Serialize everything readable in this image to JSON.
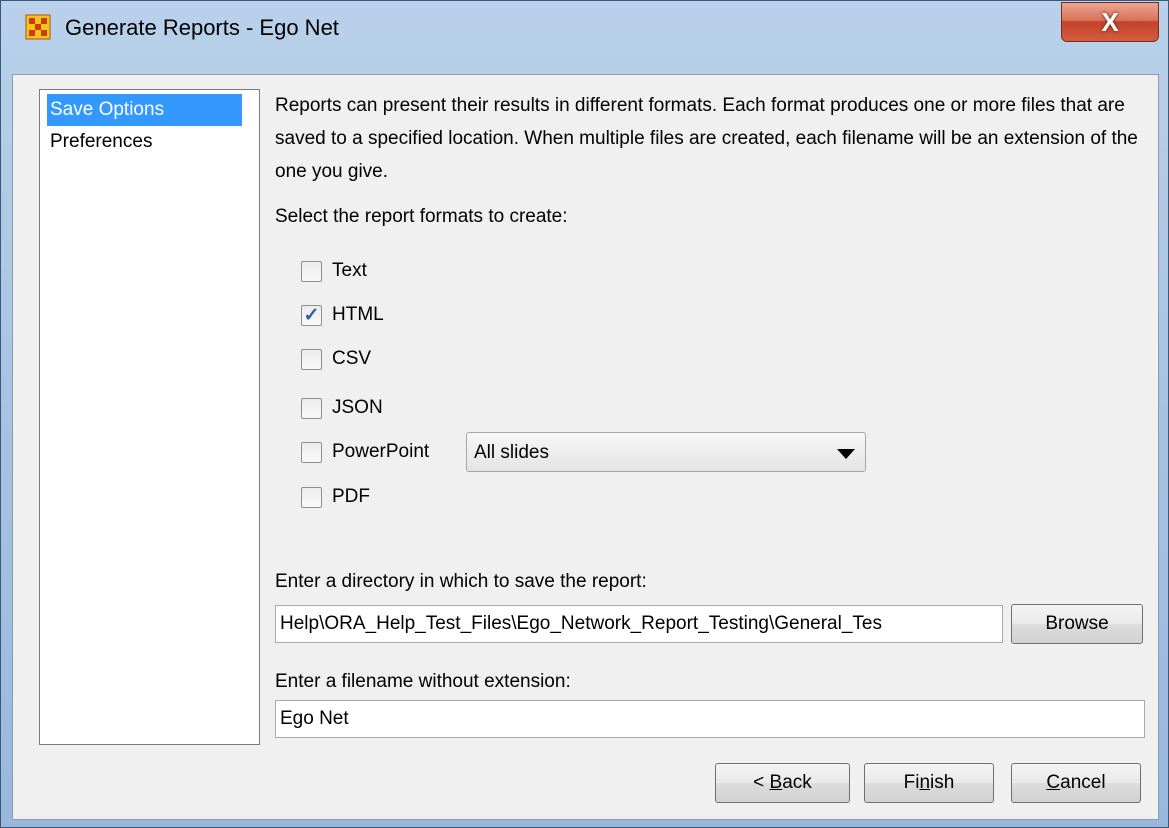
{
  "window": {
    "title": "Generate Reports - Ego Net",
    "close_symbol": "X"
  },
  "sidebar": {
    "items": [
      {
        "label": "Save Options",
        "selected": true
      },
      {
        "label": "Preferences",
        "selected": false
      }
    ]
  },
  "save_options": {
    "description": "Reports can present their results in different formats. Each format produces one or more files that are saved to a specified location. When multiple files are created, each filename will be an extension of the one you give.",
    "formats_prompt": "Select the report formats to create:",
    "formats": [
      {
        "label": "Text",
        "checked": false
      },
      {
        "label": "HTML",
        "checked": true
      },
      {
        "label": "CSV",
        "checked": false
      },
      {
        "label": "JSON",
        "checked": false
      },
      {
        "label": "PowerPoint",
        "checked": false
      },
      {
        "label": "PDF",
        "checked": false
      }
    ],
    "powerpoint_select": {
      "value": "All slides"
    },
    "directory_prompt": "Enter a directory in which to save the report:",
    "directory_value": "Help\\ORA_Help_Test_Files\\Ego_Network_Report_Testing\\General_Tes",
    "browse_label": "Browse",
    "filename_prompt": "Enter a filename without extension:",
    "filename_value": "Ego Net"
  },
  "footer": {
    "back_prefix": "< ",
    "back_mnemonic": "B",
    "back_rest": "ack",
    "finish_pre": "Fi",
    "finish_mnemonic": "n",
    "finish_rest": "ish",
    "cancel_mnemonic": "C",
    "cancel_rest": "ancel"
  },
  "colors": {
    "selection": "#3399ff",
    "check_mark": "#2a5ea8",
    "close_button": "#c4402a"
  },
  "icons": {
    "app": "ora-grid-icon",
    "close": "close-icon",
    "dropdown": "chevron-down-icon",
    "check": "check-icon"
  }
}
